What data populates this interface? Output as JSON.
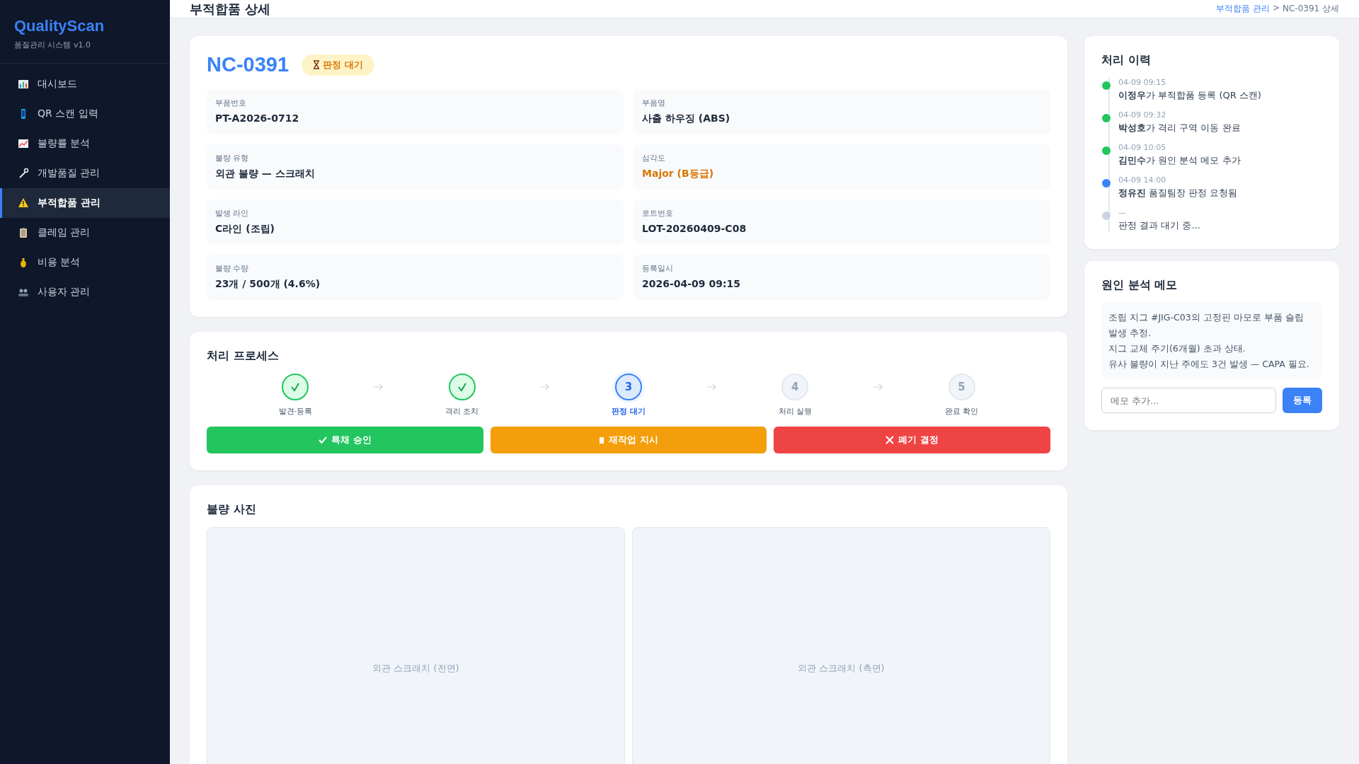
{
  "sidebar": {
    "brand": "QualityScan",
    "subtitle": "품질관리 시스템 v1.0",
    "items": [
      {
        "label": "대시보드",
        "selected": false
      },
      {
        "label": "QR 스캔 입력",
        "selected": false
      },
      {
        "label": "불량률 분석",
        "selected": false
      },
      {
        "label": "개발품질 관리",
        "selected": false
      },
      {
        "label": "부적합품 관리",
        "selected": true
      },
      {
        "label": "클레임 관리",
        "selected": false
      },
      {
        "label": "비용 분석",
        "selected": false
      },
      {
        "label": "사용자 관리",
        "selected": false
      }
    ]
  },
  "header": {
    "title": "부적합품 상세",
    "breadcrumb": {
      "link": "부적합품 관리",
      "separator": ">",
      "current": "NC-0391 상세"
    }
  },
  "detail": {
    "id": "NC-0391",
    "status": "판정 대기",
    "fields": [
      {
        "label": "부품번호",
        "value": "PT-A2026-0712",
        "kind": "normal"
      },
      {
        "label": "부품명",
        "value": "사출 하우징 (ABS)",
        "kind": "normal"
      },
      {
        "label": "불량 유형",
        "value": "외관 불량 — 스크래치",
        "kind": "normal"
      },
      {
        "label": "심각도",
        "value": "Major (B등급)",
        "kind": "warning"
      },
      {
        "label": "발생 라인",
        "value": "C라인 (조립)",
        "kind": "normal"
      },
      {
        "label": "로트번호",
        "value": "LOT-20260409-C08",
        "kind": "normal"
      },
      {
        "label": "불량 수량",
        "value": "23개 / 500개 (4.6%)",
        "kind": "normal"
      },
      {
        "label": "등록일시",
        "value": "2026-04-09 09:15",
        "kind": "normal"
      }
    ]
  },
  "process": {
    "title": "처리 프로세스",
    "steps": [
      {
        "label": "발견·등록",
        "kind": "done"
      },
      {
        "label": "격리 조치",
        "kind": "done"
      },
      {
        "number": "3",
        "label": "판정 대기",
        "kind": "current"
      },
      {
        "number": "4",
        "label": "처리 실행",
        "kind": "pending"
      },
      {
        "number": "5",
        "label": "완료 확인",
        "kind": "pending"
      }
    ],
    "actions": [
      {
        "label": "특채 승인",
        "kind": "approve"
      },
      {
        "label": "재작업 지시",
        "kind": "rework"
      },
      {
        "label": "폐기 결정",
        "kind": "scrap"
      }
    ]
  },
  "photos": {
    "title": "불량 사진",
    "items": [
      {
        "caption": "외관 스크래치 (전면)"
      },
      {
        "caption": "외관 스크래치 (측면)"
      }
    ]
  },
  "history": {
    "title": "처리 이력",
    "items": [
      {
        "time": "04-09 09:15",
        "text": "**이정우**가 부적합품 등록 (QR 스캔)",
        "color": "#22c55e"
      },
      {
        "time": "04-09 09:32",
        "text": "**박성호**가 격리 구역 이동 완료",
        "color": "#22c55e"
      },
      {
        "time": "04-09 10:05",
        "text": "**김민수**가 원인 분석 메모 추가",
        "color": "#22c55e"
      },
      {
        "time": "04-09 14:00",
        "text": "**정유진** 품질팀장 판정 요청됨",
        "color": "#3b82f6"
      },
      {
        "time": "—",
        "text": "판정 결과 대기 중...",
        "color": "#cbd5e1"
      }
    ]
  },
  "memo": {
    "title": "원인 분석 메모",
    "lines": [
      "조립 지그 #JIG-C03의 고정핀 마모로 부품 슬립 발생 추정.",
      "지그 교체 주기(6개월) 초과 상태.",
      "유사 불량이 지난 주에도 3건 발생 — CAPA 필요."
    ],
    "placeholder": "메모 추가...",
    "button": "등록"
  }
}
